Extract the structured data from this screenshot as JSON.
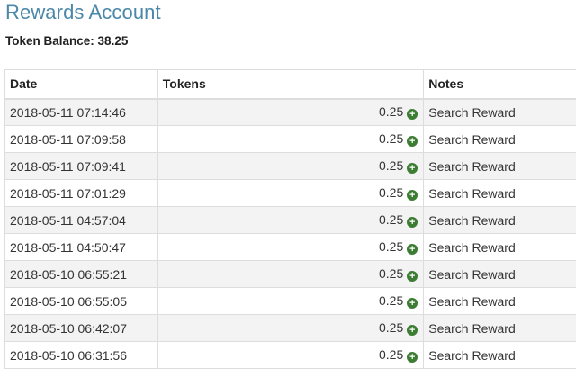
{
  "page": {
    "title": "Rewards Account",
    "balance_label": "Token Balance:",
    "balance_value": "38.25"
  },
  "table": {
    "headers": [
      "Date",
      "Tokens",
      "Notes"
    ],
    "rows": [
      {
        "date": "2018-05-11 07:14:46",
        "tokens": "0.25",
        "icon": "plus-circle-icon",
        "notes": "Search Reward"
      },
      {
        "date": "2018-05-11 07:09:58",
        "tokens": "0.25",
        "icon": "plus-circle-icon",
        "notes": "Search Reward"
      },
      {
        "date": "2018-05-11 07:09:41",
        "tokens": "0.25",
        "icon": "plus-circle-icon",
        "notes": "Search Reward"
      },
      {
        "date": "2018-05-11 07:01:29",
        "tokens": "0.25",
        "icon": "plus-circle-icon",
        "notes": "Search Reward"
      },
      {
        "date": "2018-05-11 04:57:04",
        "tokens": "0.25",
        "icon": "plus-circle-icon",
        "notes": "Search Reward"
      },
      {
        "date": "2018-05-11 04:50:47",
        "tokens": "0.25",
        "icon": "plus-circle-icon",
        "notes": "Search Reward"
      },
      {
        "date": "2018-05-10 06:55:21",
        "tokens": "0.25",
        "icon": "plus-circle-icon",
        "notes": "Search Reward"
      },
      {
        "date": "2018-05-10 06:55:05",
        "tokens": "0.25",
        "icon": "plus-circle-icon",
        "notes": "Search Reward"
      },
      {
        "date": "2018-05-10 06:42:07",
        "tokens": "0.25",
        "icon": "plus-circle-icon",
        "notes": "Search Reward"
      },
      {
        "date": "2018-05-10 06:31:56",
        "tokens": "0.25",
        "icon": "plus-circle-icon",
        "notes": "Search Reward"
      }
    ]
  },
  "colors": {
    "title": "#4a87a8",
    "plus_icon": "#3c7d33",
    "stripe": "#f3f3f3",
    "border": "#dddddd"
  }
}
